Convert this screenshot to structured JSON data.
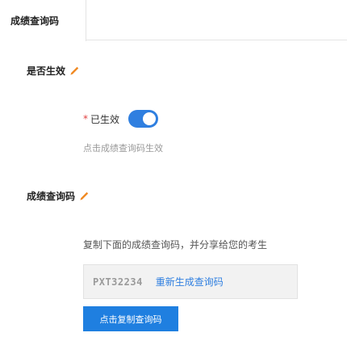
{
  "tabs": {
    "active_label": "成绩查询码"
  },
  "section_status": {
    "title": "是否生效"
  },
  "status_field": {
    "required_mark": "*",
    "label": "已生效",
    "enabled": true,
    "hint": "点击成绩查询码生效"
  },
  "section_code": {
    "title": "成绩查询码"
  },
  "code_area": {
    "description": "复制下面的成绩查询码，并分享给您的考生",
    "code_value": "PXT32234",
    "regenerate_label": "重新生成查询码",
    "copy_button_label": "点击复制查询码"
  },
  "colors": {
    "accent": "#1f7fe0",
    "edit_icon": "#f08a24",
    "required": "#e04040"
  },
  "icons": {
    "edit": "pencil-edit-icon"
  }
}
